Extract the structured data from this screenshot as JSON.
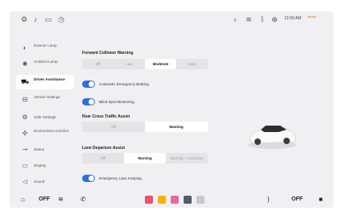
{
  "status_bar": {
    "icons": [
      "gear-icon",
      "bell-icon",
      "battery-icon",
      "clock-icon",
      "mic-icon",
      "wifi-icon",
      "bluetooth-icon",
      "signal-icon"
    ],
    "time": "12:00 AM",
    "logo_text": "BRAND"
  },
  "sidebar": {
    "items": [
      {
        "label": "Exterior Lamp",
        "icon": "lamp-icon"
      },
      {
        "label": "Ambient Lamp",
        "icon": "sun-icon"
      },
      {
        "label": "Driver Assistance",
        "icon": "car-icon",
        "active": true
      },
      {
        "label": "Vehicle Settings",
        "icon": "vehicle-icon"
      },
      {
        "label": "Safe Settings",
        "icon": "gear-icon"
      },
      {
        "label": "Environment Comfort",
        "icon": "fan-icon"
      },
      {
        "label": "Status",
        "icon": "status-icon"
      },
      {
        "label": "Display",
        "icon": "display-icon"
      },
      {
        "label": "Sound",
        "icon": "speaker-icon"
      }
    ]
  },
  "main": {
    "fcw": {
      "title": "Forward Collision Warning",
      "options": [
        "Off",
        "Late",
        "Moderate",
        "Early"
      ],
      "selected": "Moderate"
    },
    "aeb": {
      "label": "Automatic Emergency Braking",
      "on": true
    },
    "bsm": {
      "label": "Blind Spot Monitoring",
      "on": true
    },
    "rcta": {
      "title": "Rear Cross Traffic Assist",
      "options": [
        "Off",
        "Warning"
      ],
      "selected": "Warning"
    },
    "lda": {
      "title": "Lane Departure Assist",
      "options": [
        "Off",
        "Warning",
        "Warning + Correction"
      ],
      "selected": "Warning"
    },
    "elk": {
      "label": "Emergency Lane Keeping",
      "on": true
    }
  },
  "bottom_bar": {
    "left_temp": "OFF",
    "right_temp": "OFF",
    "app_colors": [
      "#e8546a",
      "#f5b400",
      "#e86aa0",
      "#555a66",
      "#c8c8cc"
    ]
  }
}
